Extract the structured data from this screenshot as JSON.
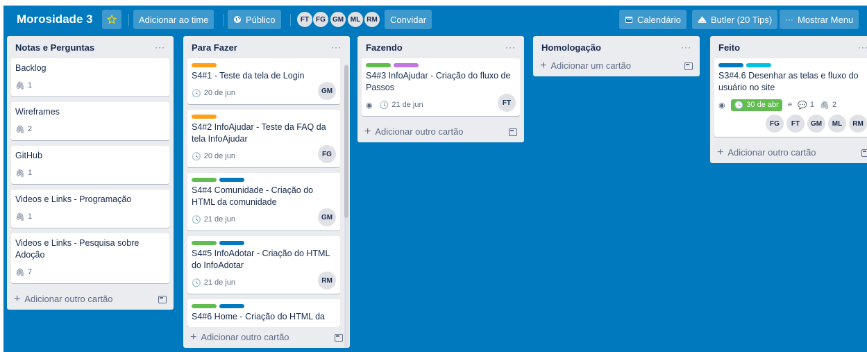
{
  "header": {
    "board_title": "Morosidade 3",
    "add_team": "Adicionar ao time",
    "visibility": "Público",
    "invite": "Convidar",
    "calendar": "Calendário",
    "butler": "Butler (20 Tips)",
    "show_menu": "Mostrar Menu",
    "members": [
      "FT",
      "FG",
      "GM",
      "ML",
      "RM"
    ],
    "star_color": "#f2d600"
  },
  "colors": {
    "board_bg": "#0079bf",
    "label_orange": "#ff9f1a",
    "label_green": "#61bd4f",
    "label_blue": "#0079bf",
    "label_purple": "#c377e0",
    "label_sky": "#00c2e0",
    "due_complete": "#61bd4f"
  },
  "lists": [
    {
      "title": "Notas e Perguntas",
      "menu": "···",
      "add_label": "Adicionar outro cartão",
      "cards": [
        {
          "title": "Backlog",
          "attachments": "1"
        },
        {
          "title": "Wireframes",
          "attachments": "2"
        },
        {
          "title": "GitHub",
          "attachments": "1"
        },
        {
          "title": "Videos e Links - Programação",
          "attachments": "1"
        },
        {
          "title": "Videos e Links - Pesquisa sobre Adoção",
          "attachments": "7"
        }
      ]
    },
    {
      "title": "Para Fazer",
      "menu": "···",
      "add_label": "Adicionar outro cartão",
      "cards": [
        {
          "labels": [
            "orange"
          ],
          "title": "S4#1 - Teste da tela de Login",
          "due": "20 de jun",
          "member": "GM"
        },
        {
          "labels": [
            "orange"
          ],
          "title": "S4#2 InfoAjudar - Teste da FAQ da tela InfoAjudar",
          "due": "20 de jun",
          "member": "FG"
        },
        {
          "labels": [
            "green",
            "blue"
          ],
          "title": "S4#4 Comunidade - Criação do HTML da comunidade",
          "due": "21 de jun",
          "member": "GM"
        },
        {
          "labels": [
            "green",
            "blue"
          ],
          "title": "S4#5 InfoAdotar - Criação do HTML do InfoAdotar",
          "due": "21 de jun",
          "member": "RM"
        },
        {
          "labels": [
            "green",
            "blue"
          ],
          "title": "S4#6 Home - Criação do HTML da"
        }
      ]
    },
    {
      "title": "Fazendo",
      "menu": "···",
      "add_label": "Adicionar outro cartão",
      "cards": [
        {
          "labels": [
            "green",
            "purple"
          ],
          "title": "S4#3 InfoAjudar - Criação do fluxo de Passos",
          "due": "21 de jun",
          "member": "FT",
          "watching": true
        }
      ]
    },
    {
      "title": "Homologação",
      "menu": "···",
      "add_label": "Adicionar um cartão",
      "cards": []
    },
    {
      "title": "Feito",
      "menu": "···",
      "add_label": "Adicionar outro cartão",
      "cards": [
        {
          "labels": [
            "blue",
            "sky"
          ],
          "title": "S3#4.6 Desenhar as telas e fluxo do usuário no site",
          "due": "30 de abr",
          "comments": "1",
          "attachments": "2",
          "members": [
            "FG",
            "FT",
            "GM",
            "ML",
            "RM"
          ]
        }
      ]
    }
  ]
}
